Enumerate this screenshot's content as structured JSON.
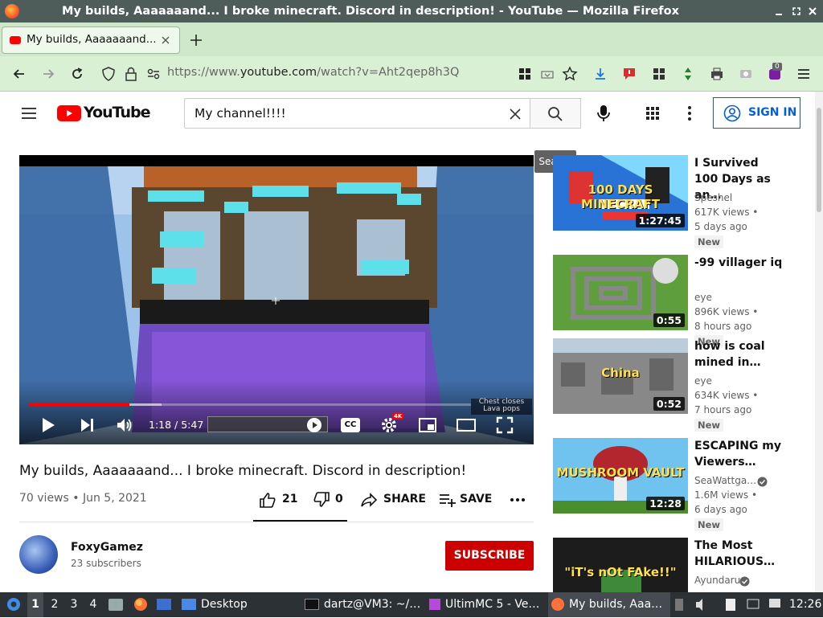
{
  "window": {
    "title": "My builds, Aaaaaaand... I broke minecraft. Discord in description! - YouTube — Mozilla Firefox"
  },
  "tab": {
    "label": "My builds, Aaaaaaand... I b"
  },
  "nav": {
    "url_prefix": "https://www.",
    "url_domain": "youtube.com",
    "url_path": "/watch?v=Aht2qep8h3Q",
    "ext_badge": "0"
  },
  "yt": {
    "logo_text": "YouTube",
    "search_value": "My channel!!!!",
    "search_tooltip": "Search",
    "signin_label": "SIGN IN"
  },
  "player": {
    "time": "1:18 / 5:47",
    "progress_fraction": 0.227,
    "buffered_fraction": 0.3,
    "quality_badge": "4K",
    "subtitle_line1": "Chest closes",
    "subtitle_line2": "Lava pops"
  },
  "video": {
    "title": "My builds, Aaaaaaand... I broke minecraft. Discord in description!",
    "views_date": "70 views • Jun 5, 2021",
    "likes": "21",
    "dislikes": "0",
    "share_label": "SHARE",
    "save_label": "SAVE"
  },
  "channel": {
    "name": "FoxyGamez",
    "subs": "23 subscribers",
    "subscribe_label": "SUBSCRIBE"
  },
  "recommendations": [
    {
      "title": "I Survived 100 Days as an…",
      "channel": "Speshel",
      "views": "617K views •",
      "age": "5 days ago",
      "badge": "New",
      "duration": "1:27:45",
      "verified": false,
      "thumb_text": "100 DAYS MINECRAFT"
    },
    {
      "title": "-99 villager iq",
      "channel": "eye",
      "views": "896K views •",
      "age": "8 hours ago",
      "badge": "New",
      "duration": "0:55",
      "verified": false,
      "thumb_text": ""
    },
    {
      "title": "how is coal mined in…",
      "channel": "eye",
      "views": "634K views •",
      "age": "7 hours ago",
      "badge": "New",
      "duration": "0:52",
      "verified": false,
      "thumb_text": "China"
    },
    {
      "title": "ESCAPING my Viewers…",
      "channel": "SeaWattga…",
      "views": "1.6M views •",
      "age": "6 days ago",
      "badge": "New",
      "duration": "12:28",
      "verified": true,
      "thumb_text": "MUSHROOM VAULT"
    },
    {
      "title": "The Most HILARIOUS…",
      "channel": "Ayundaru",
      "views": "",
      "age": "",
      "badge": "",
      "duration": "",
      "verified": true,
      "thumb_text": "\"iT's nOt FAke!!\""
    }
  ],
  "taskbar": {
    "workspaces": [
      "1",
      "2",
      "3",
      "4"
    ],
    "desktop_label": "Desktop",
    "terminal_label": "dartz@VM3: ~/…",
    "ultimmc_label": "UltimMC 5 - Ve…",
    "firefox_label": "My builds, Aaa…",
    "clock": "12:26"
  },
  "colors": {
    "yt_red": "#ff0000",
    "link_blue": "#065fd4",
    "tabbar": "#cfe8c9",
    "titlebar": "#4e5d5a",
    "taskbar": "#2c3135"
  }
}
